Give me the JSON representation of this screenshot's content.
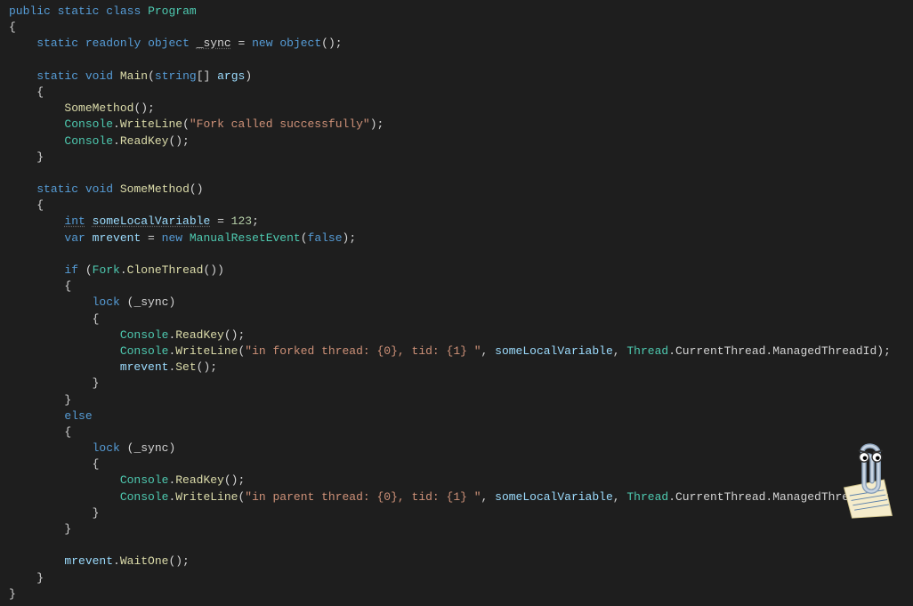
{
  "code": {
    "l1_public": "public",
    "l1_static": "static",
    "l1_class": "class",
    "l1_Program": "Program",
    "l2_brace": "{",
    "l3_static": "static",
    "l3_readonly": "readonly",
    "l3_object": "object",
    "l3_sync": "_sync",
    "l3_eq": " = ",
    "l3_new": "new",
    "l3_object2": "object",
    "l3_parens": "();",
    "l5_static": "static",
    "l5_void": "void",
    "l5_Main": "Main",
    "l5_string": "string",
    "l5_brackets": "[] ",
    "l5_args": "args",
    "l5_close": ")",
    "l6_brace": "{",
    "l7_SomeMethod": "SomeMethod",
    "l7_parens": "();",
    "l8_Console": "Console",
    "l8_dot": ".",
    "l8_WriteLine": "WriteLine",
    "l8_open": "(",
    "l8_str": "\"Fork called successfully\"",
    "l8_close": ");",
    "l9_Console": "Console",
    "l9_ReadKey": "ReadKey",
    "l9_parens": "();",
    "l10_brace": "}",
    "l12_static": "static",
    "l12_void": "void",
    "l12_SomeMethod": "SomeMethod",
    "l12_parens": "()",
    "l13_brace": "{",
    "l14_int": "int",
    "l14_var": "someLocalVariable",
    "l14_eq": " = ",
    "l14_num": "123",
    "l14_semi": ";",
    "l15_var": "var",
    "l15_mrevent": "mrevent",
    "l15_eq": " = ",
    "l15_new": "new",
    "l15_ManualResetEvent": "ManualResetEvent",
    "l15_open": "(",
    "l15_false": "false",
    "l15_close": ");",
    "l17_if": "if",
    "l17_open": " (",
    "l17_Fork": "Fork",
    "l17_dot": ".",
    "l17_CloneThread": "CloneThread",
    "l17_parens": "())",
    "l18_brace": "{",
    "l19_lock": "lock",
    "l19_open": " (",
    "l19_sync": "_sync",
    "l19_close": ")",
    "l20_brace": "{",
    "l21_Console": "Console",
    "l21_ReadKey": "ReadKey",
    "l21_parens": "();",
    "l22_Console": "Console",
    "l22_WriteLine": "WriteLine",
    "l22_open": "(",
    "l22_str": "\"in forked thread: {0}, tid: {1} \"",
    "l22_comma1": ", ",
    "l22_someLocal": "someLocalVariable",
    "l22_comma2": ", ",
    "l22_Thread": "Thread",
    "l22_dot2": ".",
    "l22_CurrentThread": "CurrentThread",
    "l22_dot3": ".",
    "l22_ManagedThreadId": "ManagedThreadId",
    "l22_close": ");",
    "l23_mrevent": "mrevent",
    "l23_dot": ".",
    "l23_Set": "Set",
    "l23_parens": "();",
    "l24_brace": "}",
    "l25_brace": "}",
    "l26_else": "else",
    "l27_brace": "{",
    "l28_lock": "lock",
    "l28_open": " (",
    "l28_sync": "_sync",
    "l28_close": ")",
    "l29_brace": "{",
    "l30_Console": "Console",
    "l30_ReadKey": "ReadKey",
    "l30_parens": "();",
    "l31_Console": "Console",
    "l31_WriteLine": "WriteLine",
    "l31_open": "(",
    "l31_str": "\"in parent thread: {0}, tid: {1} \"",
    "l31_comma1": ", ",
    "l31_someLocal": "someLocalVariable",
    "l31_comma2": ", ",
    "l31_Thread": "Thread",
    "l31_dot2": ".",
    "l31_CurrentThread": "CurrentThread",
    "l31_dot3": ".",
    "l31_ManagedThreadId": "ManagedThreadId",
    "l31_close": ");",
    "l32_brace": "}",
    "l33_brace": "}",
    "l35_mrevent": "mrevent",
    "l35_dot": ".",
    "l35_WaitOne": "WaitOne",
    "l35_parens": "();",
    "l36_brace": "}",
    "l37_brace": "}"
  }
}
